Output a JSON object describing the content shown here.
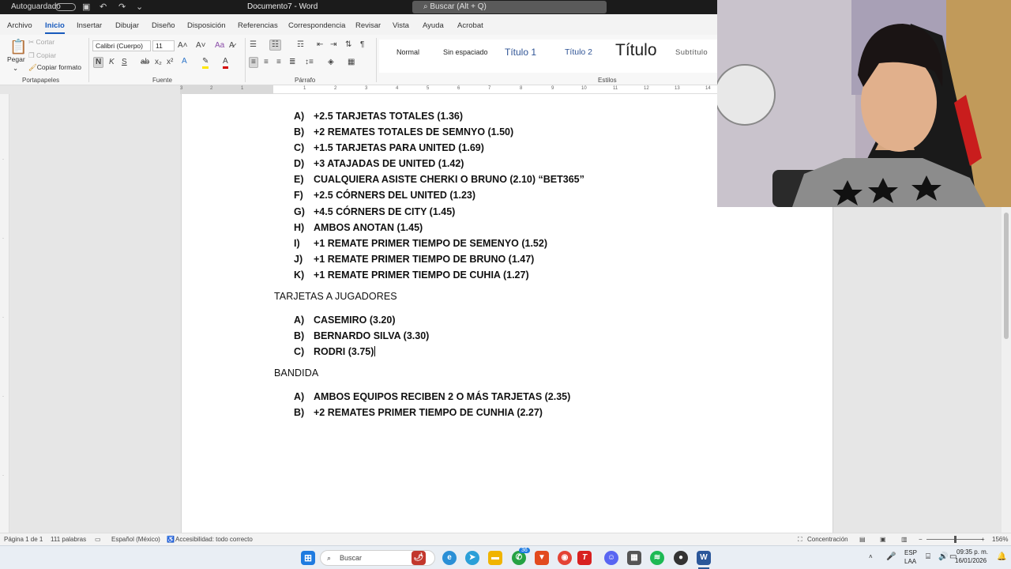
{
  "titlebar": {
    "autosave_label": "Autoguardado",
    "document_title": "Documento7 - Word",
    "search_placeholder": "Buscar (Alt + Q)"
  },
  "ribbon": {
    "tabs": [
      "Archivo",
      "Inicio",
      "Insertar",
      "Dibujar",
      "Diseño",
      "Disposición",
      "Referencias",
      "Correspondencia",
      "Revisar",
      "Vista",
      "Ayuda",
      "Acrobat"
    ],
    "active_tab": "Inicio",
    "clipboard": {
      "paste": "Pegar",
      "cut": "Cortar",
      "copy": "Copiar",
      "format_painter": "Copiar formato",
      "group": "Portapapeles"
    },
    "font": {
      "family": "Calibri (Cuerpo)",
      "size": "11",
      "group": "Fuente"
    },
    "paragraph": {
      "group": "Párrafo"
    },
    "styles": {
      "items": [
        "Normal",
        "Sin espaciado",
        "Título 1",
        "Título 2",
        "Título",
        "Subtítulo"
      ],
      "group": "Estilos"
    }
  },
  "document": {
    "list1": [
      {
        "marker": "A)",
        "text": "+2.5 TARJETAS TOTALES (1.36)"
      },
      {
        "marker": "B)",
        "text": "+2 REMATES TOTALES DE SEMNYO (1.50)"
      },
      {
        "marker": "C)",
        "text": "+1.5 TARJETAS PARA UNITED (1.69)"
      },
      {
        "marker": "D)",
        "text": "+3 ATAJADAS DE UNITED (1.42)"
      },
      {
        "marker": "E)",
        "text": "CUALQUIERA ASISTE CHERKI O BRUNO (2.10) “BET365”"
      },
      {
        "marker": "F)",
        "text": "+2.5 CÓRNERS DEL UNITED (1.23)"
      },
      {
        "marker": "G)",
        "text": "+4.5 CÓRNERS DE CITY (1.45)"
      },
      {
        "marker": "H)",
        "text": "AMBOS ANOTAN (1.45)"
      },
      {
        "marker": "I)",
        "text": "+1 REMATE PRIMER TIEMPO DE SEMENYO (1.52)"
      },
      {
        "marker": "J)",
        "text": "+1 REMATE PRIMER TIEMPO DE BRUNO (1.47)"
      },
      {
        "marker": "K)",
        "text": "+1 REMATE PRIMER TIEMPO DE CUHIA (1.27)"
      }
    ],
    "heading2": "TARJETAS A JUGADORES",
    "list2": [
      {
        "marker": "A)",
        "text": "CASEMIRO (3.20)"
      },
      {
        "marker": "B)",
        "text": "BERNARDO SILVA (3.30)"
      },
      {
        "marker": "C)",
        "text": "RODRI (3.75)"
      }
    ],
    "heading3": "BANDIDA",
    "list3": [
      {
        "marker": "A)",
        "text": "AMBOS EQUIPOS RECIBEN 2 O MÁS TARJETAS (2.35)"
      },
      {
        "marker": "B)",
        "text": "+2 REMATES PRIMER TIEMPO DE CUNHIA (2.27)"
      }
    ]
  },
  "statusbar": {
    "page": "Página 1 de 1",
    "words": "111 palabras",
    "language": "Español (México)",
    "accessibility": "Accesibilidad: todo correcto",
    "focus": "Concentración",
    "zoom": "156%"
  },
  "taskbar": {
    "search_placeholder": "Buscar",
    "badge_count": "36",
    "lang_line1": "ESP",
    "lang_line2": "LAA",
    "time": "09:35 p. m.",
    "date": "16/01/2026"
  },
  "colors": {
    "accent": "#185abd",
    "titlebar": "#1b1b1b",
    "taskbar": "#e9eef4"
  }
}
